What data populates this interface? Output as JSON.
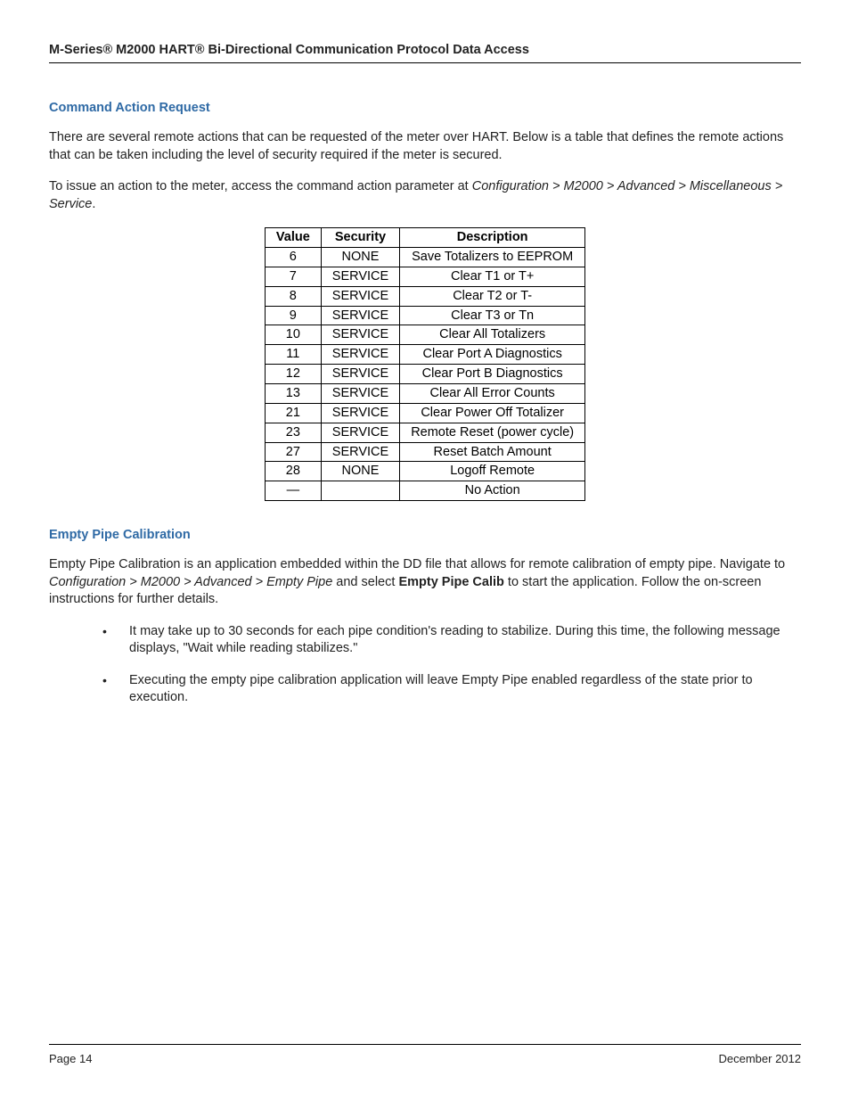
{
  "header": {
    "title": "M-Series® M2000 HART® Bi-Directional Communication Protocol Data Access"
  },
  "section1": {
    "heading": "Command Action Request",
    "para1": "There are several remote actions that can be requested of the meter over HART. Below is a table that defines the remote actions that can be taken including the level of security required if the meter is secured.",
    "para2_pre": "To issue an action to the meter, access the command action parameter at ",
    "para2_path": "Configuration > M2000 > Advanced > Miscellaneous > Service",
    "para2_post": "."
  },
  "table": {
    "headers": {
      "col1": "Value",
      "col2": "Security",
      "col3": "Description"
    },
    "rows": [
      {
        "value": "6",
        "security": "NONE",
        "description": "Save Totalizers to EEPROM"
      },
      {
        "value": "7",
        "security": "SERVICE",
        "description": "Clear T1 or T+"
      },
      {
        "value": "8",
        "security": "SERVICE",
        "description": "Clear T2 or T-"
      },
      {
        "value": "9",
        "security": "SERVICE",
        "description": "Clear T3 or Tn"
      },
      {
        "value": "10",
        "security": "SERVICE",
        "description": "Clear All Totalizers"
      },
      {
        "value": "11",
        "security": "SERVICE",
        "description": "Clear Port A Diagnostics"
      },
      {
        "value": "12",
        "security": "SERVICE",
        "description": "Clear Port B Diagnostics"
      },
      {
        "value": "13",
        "security": "SERVICE",
        "description": "Clear All Error Counts"
      },
      {
        "value": "21",
        "security": "SERVICE",
        "description": "Clear Power Off Totalizer"
      },
      {
        "value": "23",
        "security": "SERVICE",
        "description": "Remote Reset (power cycle)"
      },
      {
        "value": "27",
        "security": "SERVICE",
        "description": "Reset Batch Amount"
      },
      {
        "value": "28",
        "security": "NONE",
        "description": "Logoff Remote"
      },
      {
        "value": "—",
        "security": "",
        "description": "No Action"
      }
    ]
  },
  "section2": {
    "heading": "Empty Pipe Calibration",
    "para1_pre": "Empty Pipe Calibration is an application embedded within the DD file that allows for remote calibration of empty pipe. Navigate to ",
    "para1_path": "Configuration > M2000 > Advanced > Empty Pipe",
    "para1_mid": " and select ",
    "para1_bold": "Empty Pipe Calib",
    "para1_post": " to start the application. Follow the on-screen instructions for further details.",
    "bullets": [
      "It may take up to 30 seconds for each pipe condition's reading to stabilize. During this time, the following message displays, \"Wait while reading stabilizes.\"",
      "Executing the empty pipe calibration application will leave Empty Pipe enabled regardless of the state prior to execution."
    ]
  },
  "footer": {
    "left": "Page 14",
    "right": "December 2012"
  }
}
